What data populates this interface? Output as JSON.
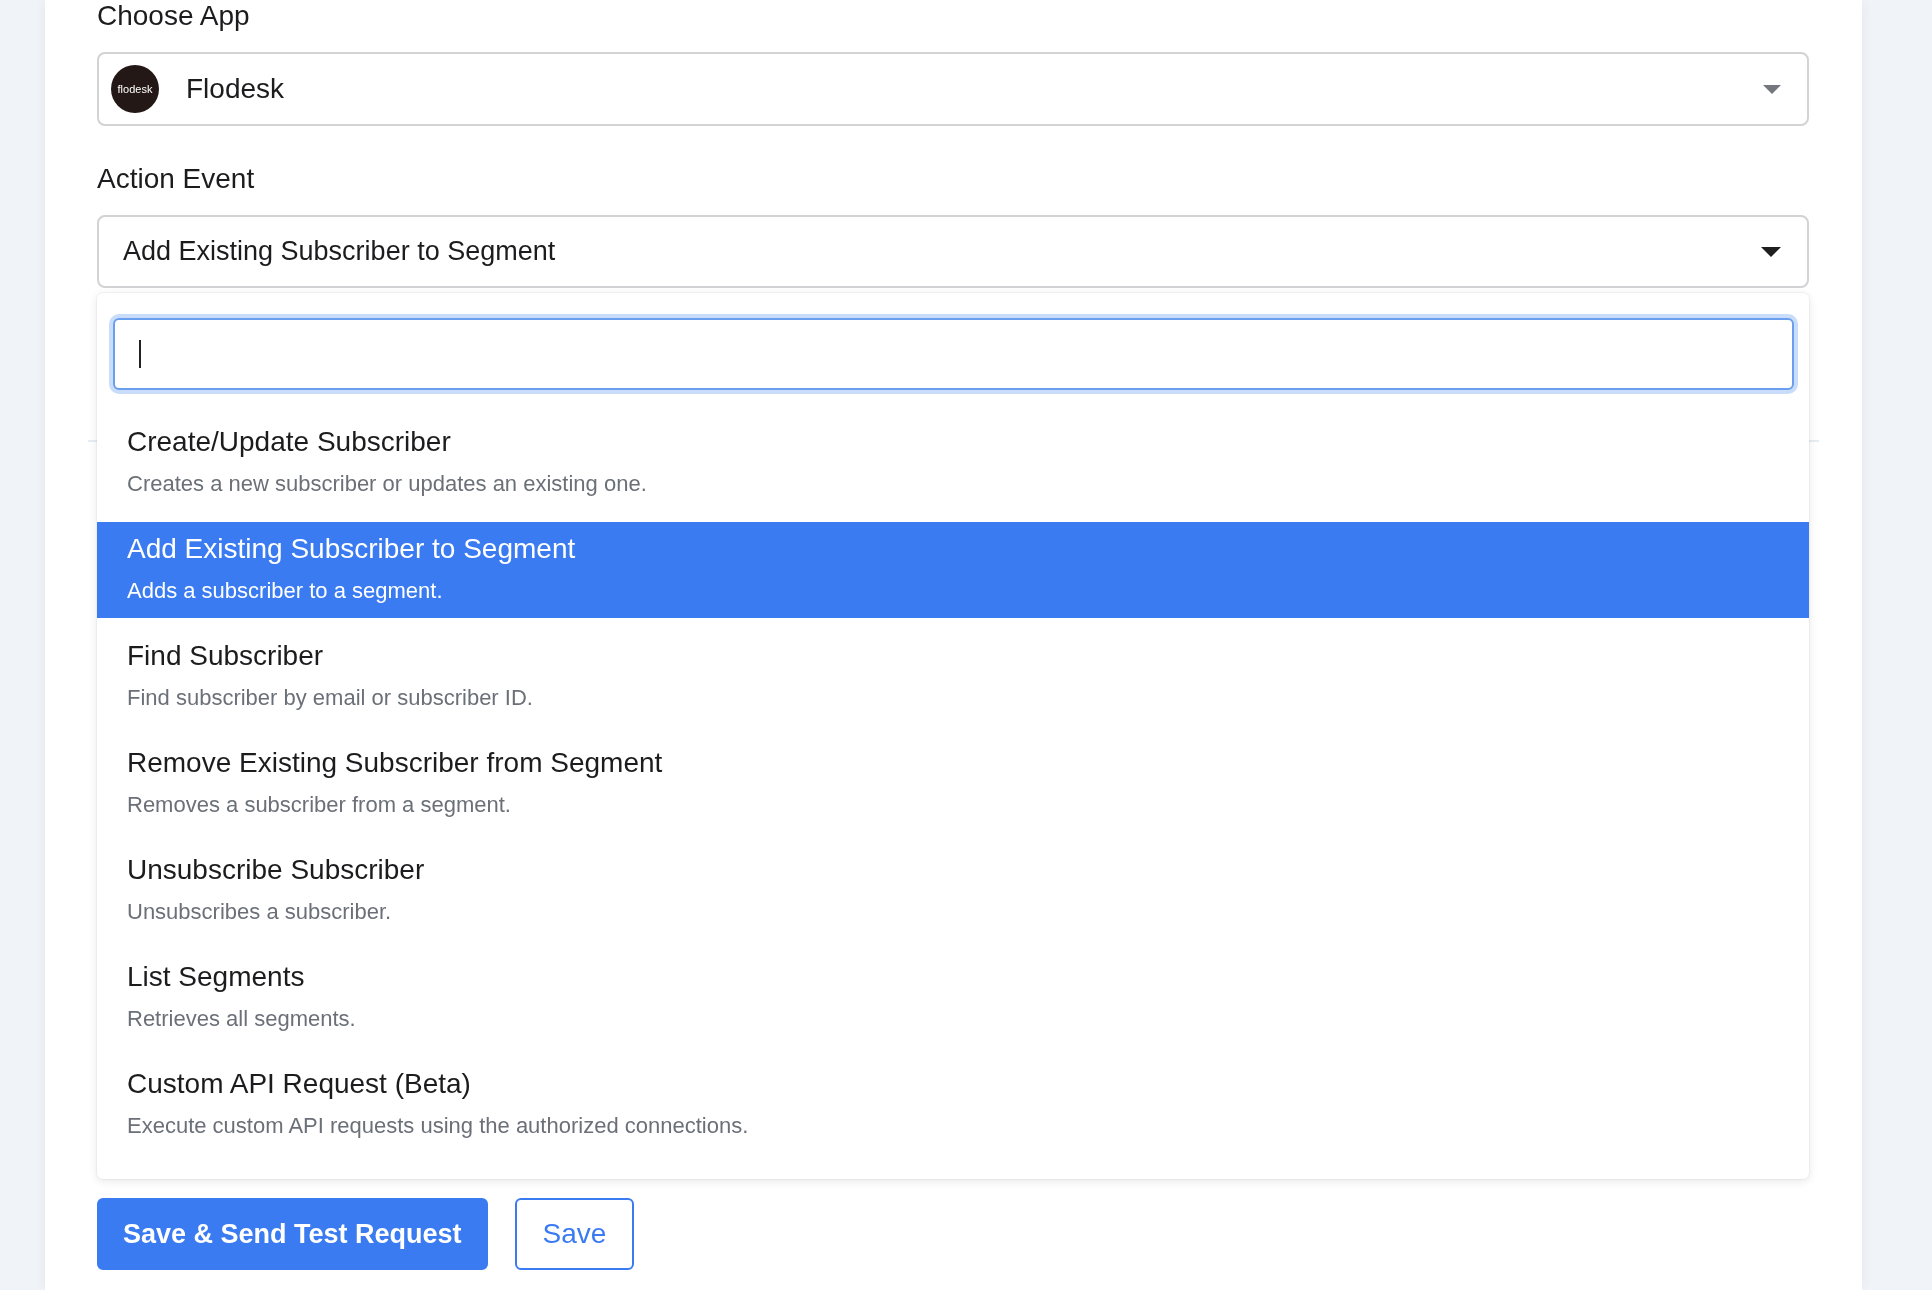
{
  "form": {
    "fields": [
      {
        "kind": "app_select",
        "label": "Choose App",
        "logo_text": "flodesk",
        "value": "Flodesk",
        "open": false
      },
      {
        "kind": "event_select",
        "label": "Action Event",
        "value": "Add Existing Subscriber to Segment",
        "open": true,
        "dropdown": {
          "search_field": {
            "focused": true
          },
          "options": [
            {
              "title": "Create/Update Subscriber",
              "description": "Creates a new subscriber or updates an existing one.",
              "selected": false
            },
            {
              "title": "Add Existing Subscriber to Segment",
              "description": "Adds a subscriber to a segment.",
              "selected": true
            },
            {
              "title": "Find Subscriber",
              "description": "Find subscriber by email or subscriber ID.",
              "selected": false
            },
            {
              "title": "Remove Existing Subscriber from Segment",
              "description": "Removes a subscriber from a segment.",
              "selected": false
            },
            {
              "title": "Unsubscribe Subscriber",
              "description": "Unsubscribes a subscriber.",
              "selected": false
            },
            {
              "title": "List Segments",
              "description": "Retrieves all segments.",
              "selected": false
            },
            {
              "title": "Custom API Request (Beta)",
              "description": "Execute custom API requests using the authorized connections.",
              "selected": false
            }
          ]
        }
      }
    ],
    "buttons": [
      {
        "label": "Save & Send Test Request",
        "kind": "primary"
      },
      {
        "label": "Save",
        "kind": "outline"
      }
    ]
  }
}
